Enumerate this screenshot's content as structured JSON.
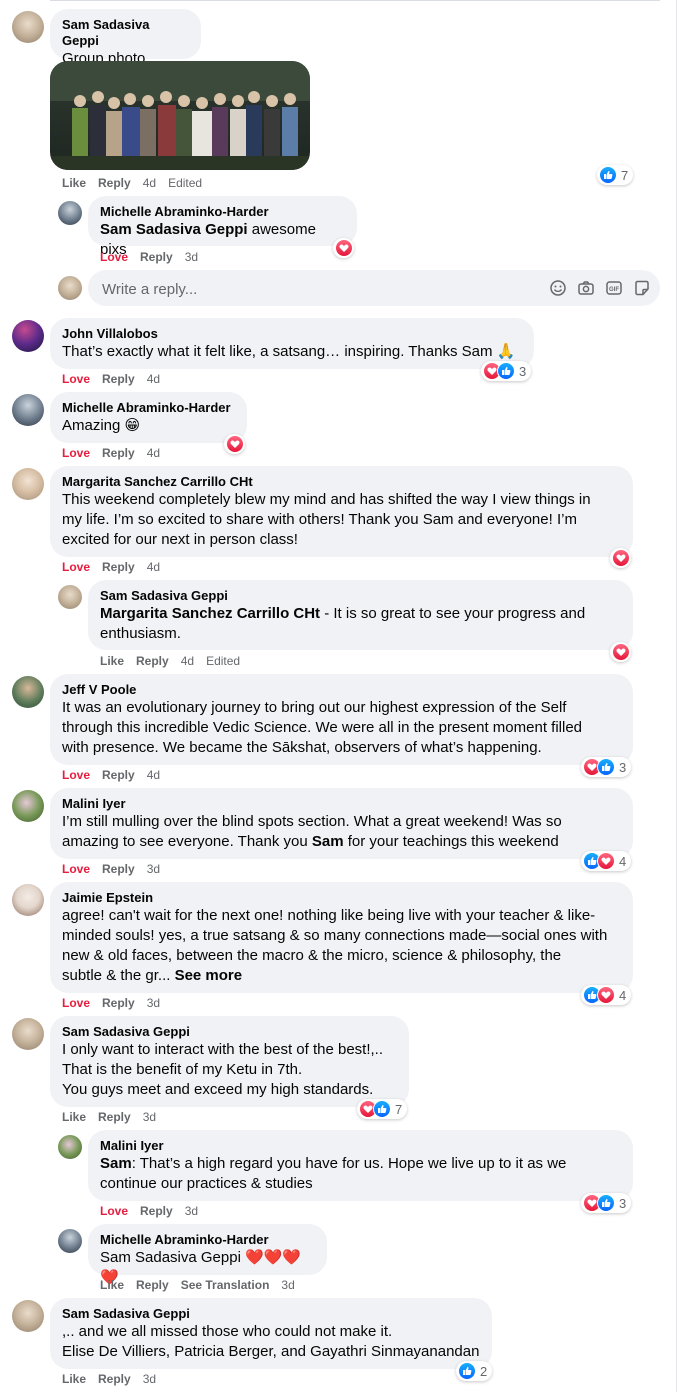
{
  "comments": {
    "c1": {
      "author": "Sam Sadasiva Geppi",
      "text": "Group photo.",
      "like": "Like",
      "reply": "Reply",
      "time": "4d",
      "edited": "Edited",
      "count": "7"
    },
    "r1": {
      "author": "Michelle Abraminko-Harder",
      "mention": "Sam Sadasiva Geppi",
      "text": " awesome pixs",
      "love": "Love",
      "reply": "Reply",
      "time": "3d"
    },
    "c2": {
      "author": "John Villalobos",
      "text": "That’s exactly what it felt like, a satsang… inspiring. Thanks Sam 🙏",
      "love": "Love",
      "reply": "Reply",
      "time": "4d",
      "count": "3"
    },
    "c3": {
      "author": "Michelle Abraminko-Harder",
      "text": "Amazing 😁",
      "love": "Love",
      "reply": "Reply",
      "time": "4d"
    },
    "c4": {
      "author": "Margarita Sanchez Carrillo CHt",
      "lines": [
        "This weekend completely blew my mind and has shifted the way I view things in",
        "my life. I’m so excited to share with others! Thank you Sam and everyone! I’m",
        "excited for our next in person class!"
      ],
      "love": "Love",
      "reply": "Reply",
      "time": "4d"
    },
    "r2": {
      "author": "Sam Sadasiva Geppi",
      "mention": "Margarita Sanchez Carrillo CHt",
      "line1": " - It is so great to see your progress and",
      "line2": "enthusiasm.",
      "like": "Like",
      "reply": "Reply",
      "time": "4d",
      "edited": "Edited"
    },
    "c5": {
      "author": "Jeff V Poole",
      "lines": [
        "It was an evolutionary journey to bring out our highest expression of the Self",
        "through this incredible Vedic Science. We were all in the present moment filled",
        "with presence. We became the Sākshat, observers of what’s happening."
      ],
      "love": "Love",
      "reply": "Reply",
      "time": "4d",
      "count": "3"
    },
    "c6": {
      "author": "Malini Iyer",
      "line1": "I’m still mulling over the blind spots section. What a great weekend! Was so",
      "line2a": "amazing to see everyone. Thank you ",
      "line2b": "Sam",
      "line2c": " for your teachings this weekend",
      "love": "Love",
      "reply": "Reply",
      "time": "3d",
      "count": "4"
    },
    "c7": {
      "author": "Jaimie Epstein",
      "lines": [
        "agree! can't wait for the next one! nothing like being live with your teacher & like-",
        "minded souls! yes, a true satsang & so many connections made—social ones with",
        "new & old faces, between the macro & the micro, science & philosophy, the"
      ],
      "line4": "subtle & the gr... ",
      "see_more": "See more",
      "love": "Love",
      "reply": "Reply",
      "time": "3d",
      "count": "4"
    },
    "c8": {
      "author": "Sam Sadasiva Geppi",
      "lines": [
        "I only want to interact with the best of the best!,..",
        "That is the benefit of my Ketu in 7th.",
        "You guys meet and exceed my high standards."
      ],
      "like": "Like",
      "reply": "Reply",
      "time": "3d",
      "count": "7"
    },
    "r3": {
      "author": "Malini Iyer",
      "mention": "Sam",
      "line1": ": That’s a high regard you have for us. Hope we live up to it as we",
      "line2": "continue our practices & studies",
      "love": "Love",
      "reply": "Reply",
      "time": "3d",
      "count": "3"
    },
    "r4": {
      "author": "Michelle Abraminko-Harder",
      "text": "Sam Sadasiva Geppi ❤️❤️❤️❤️",
      "like": "Like",
      "reply": "Reply",
      "see_translation": "See Translation",
      "time": "3d"
    },
    "c9": {
      "author": "Sam Sadasiva Geppi",
      "lines": [
        ",.. and we all missed those who could not make it.",
        "Elise De Villiers, Patricia Berger, and Gayathri Sinmayanandan"
      ],
      "like": "Like",
      "reply": "Reply",
      "time": "3d",
      "count": "2"
    }
  },
  "reply_box": {
    "placeholder": "Write a reply..."
  },
  "icons": [
    "emoji-icon",
    "camera-icon",
    "gif-icon",
    "sticker-icon"
  ],
  "colors": {
    "bubble": "#f0f2f5",
    "love": "#e41e3f",
    "like": "#0866ff",
    "meta": "#65676b"
  }
}
